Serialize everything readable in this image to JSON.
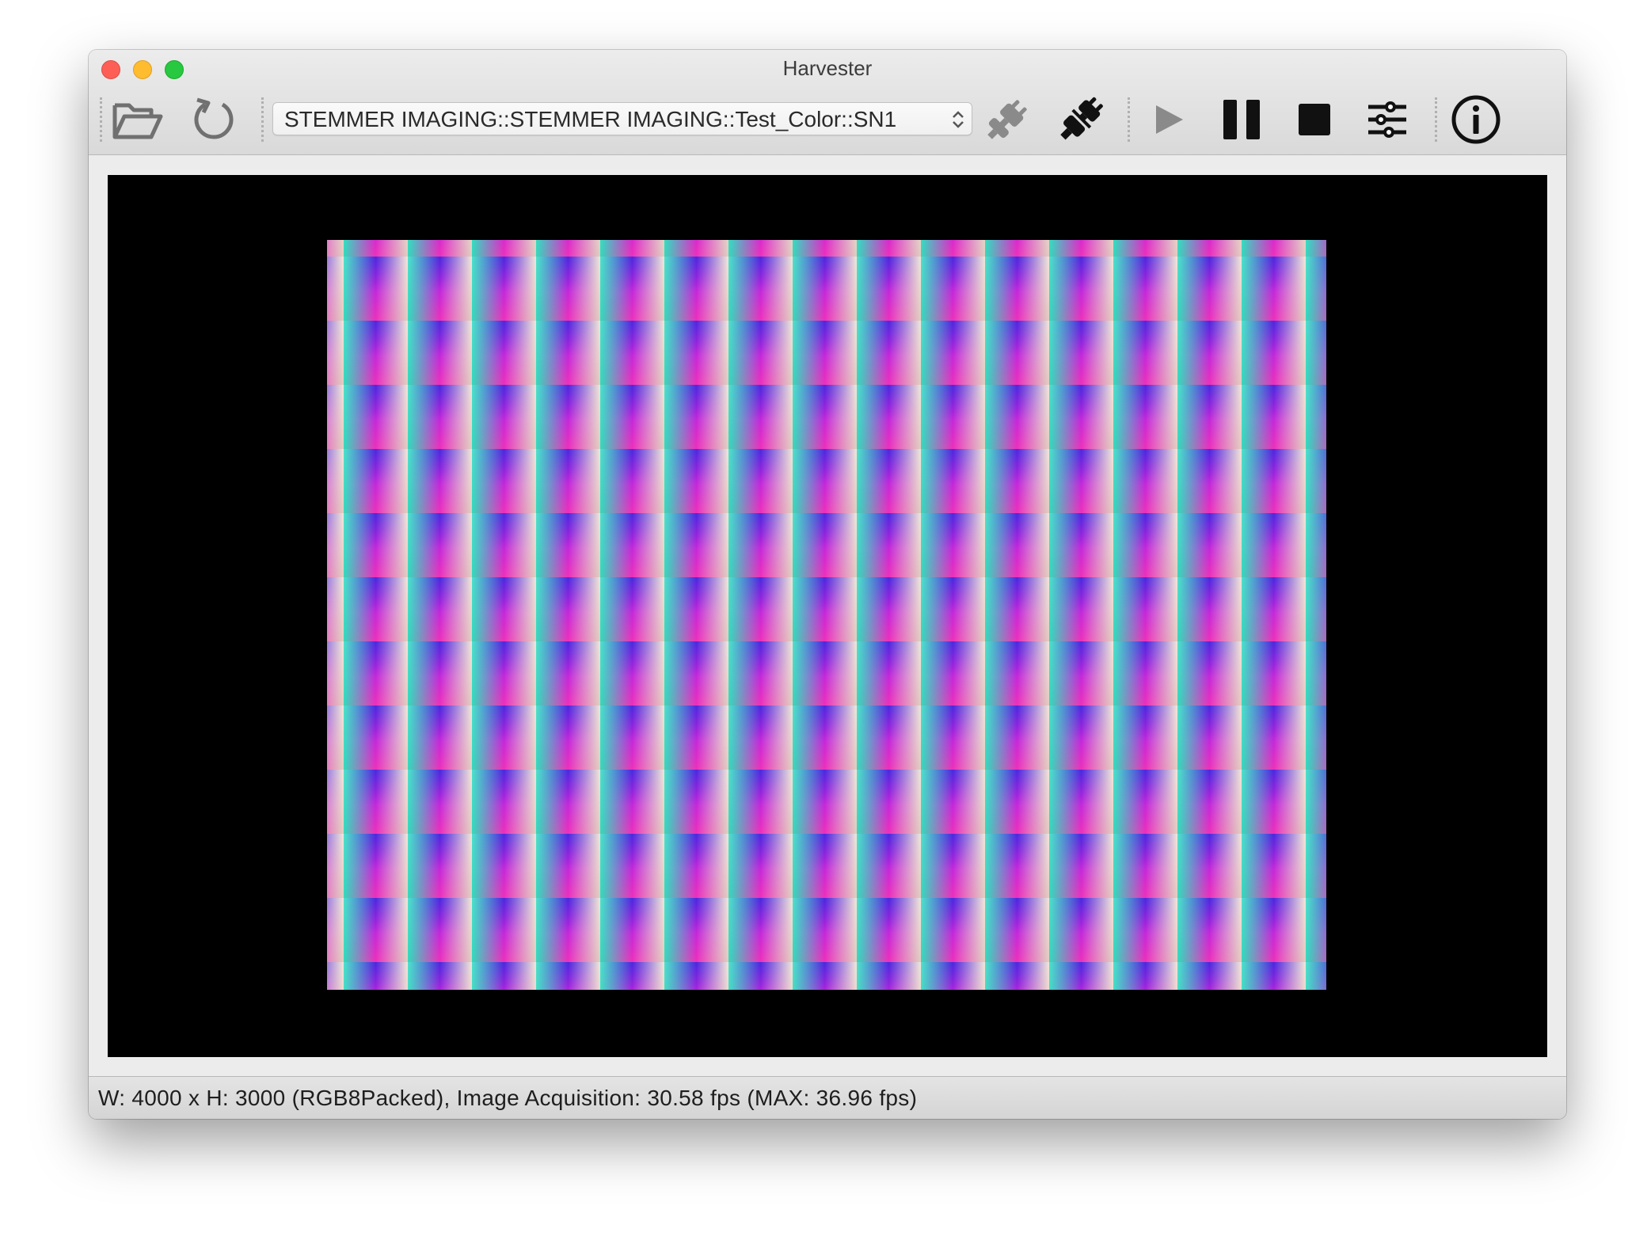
{
  "window": {
    "title": "Harvester"
  },
  "toolbar": {
    "device_selected": "STEMMER IMAGING::STEMMER IMAGING::Test_Color::SN1",
    "buttons": [
      {
        "name": "open-folder",
        "icon": "folder-open-icon"
      },
      {
        "name": "refresh",
        "icon": "refresh-icon"
      },
      {
        "name": "connect",
        "icon": "plug-connected-icon",
        "enabled": false
      },
      {
        "name": "disconnect",
        "icon": "plug-disconnect-icon",
        "enabled": true
      },
      {
        "name": "start",
        "icon": "play-icon",
        "enabled": false
      },
      {
        "name": "pause",
        "icon": "pause-icon",
        "enabled": true
      },
      {
        "name": "stop",
        "icon": "stop-icon",
        "enabled": true
      },
      {
        "name": "settings",
        "icon": "sliders-icon",
        "enabled": true
      },
      {
        "name": "about",
        "icon": "info-icon",
        "enabled": true
      }
    ]
  },
  "viewport": {
    "content": "test pattern image"
  },
  "status": {
    "text": "W: 4000 x H: 3000 (RGB8Packed), Image Acquisition: 30.58 fps (MAX: 36.96 fps)"
  },
  "colors": {
    "enabled_icon": "#111111",
    "disabled_icon": "#8a8a8a",
    "viewport_bg": "#000000"
  }
}
